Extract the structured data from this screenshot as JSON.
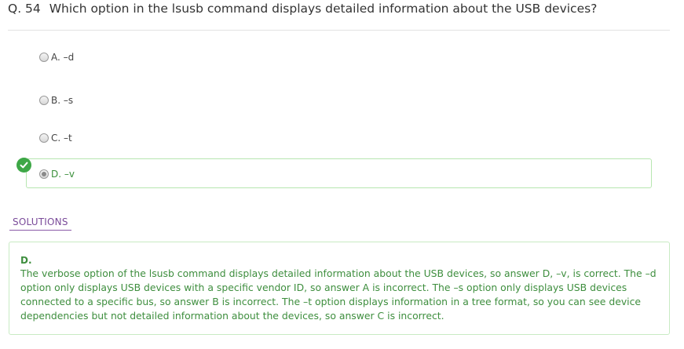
{
  "question": {
    "number": "Q. 54",
    "text": "Which option in the lsusb command displays detailed information about the USB devices?"
  },
  "options": [
    {
      "label": "A. –d",
      "selected": false,
      "correct": false
    },
    {
      "label": "B. –s",
      "selected": false,
      "correct": false
    },
    {
      "label": "C. –t",
      "selected": false,
      "correct": false
    },
    {
      "label": "D. –v",
      "selected": true,
      "correct": true
    }
  ],
  "icons": {
    "correct_indicator": "check-circle-icon"
  },
  "solutions": {
    "tab_label": "SOLUTIONS",
    "answer": "D.",
    "explanation": "The verbose option of the lsusb command displays detailed information about the USB devices, so answer D, –v, is correct. The –d option only displays USB devices with a specific vendor ID, so answer A is incorrect. The –s option only displays USB devices connected to a specific bus, so answer B is incorrect. The –t option displays information in a tree format, so you can see device dependencies but not detailed information about the devices, so answer C is incorrect."
  },
  "colors": {
    "correct_green": "#3da746",
    "correct_text": "#3e8e3e",
    "solutions_purple": "#7a4b9a"
  }
}
